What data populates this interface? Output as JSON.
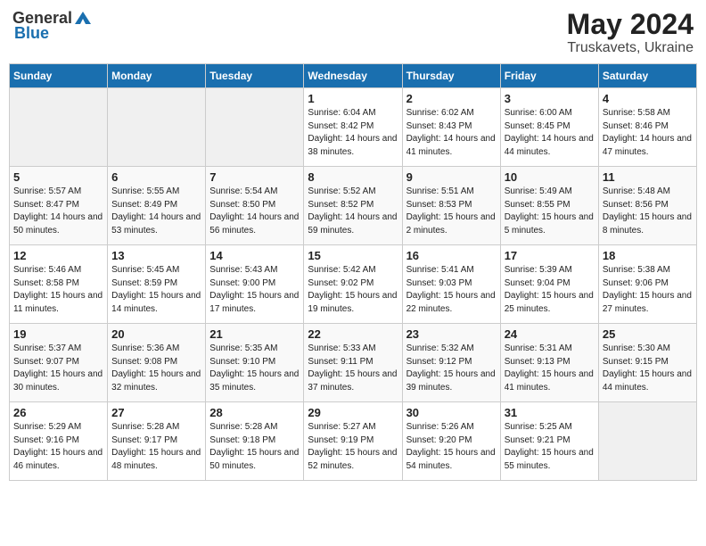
{
  "header": {
    "logo_general": "General",
    "logo_blue": "Blue",
    "month": "May 2024",
    "location": "Truskavets, Ukraine"
  },
  "days_of_week": [
    "Sunday",
    "Monday",
    "Tuesday",
    "Wednesday",
    "Thursday",
    "Friday",
    "Saturday"
  ],
  "weeks": [
    [
      {
        "day": "",
        "sunrise": "",
        "sunset": "",
        "daylight": "",
        "empty": true
      },
      {
        "day": "",
        "sunrise": "",
        "sunset": "",
        "daylight": "",
        "empty": true
      },
      {
        "day": "",
        "sunrise": "",
        "sunset": "",
        "daylight": "",
        "empty": true
      },
      {
        "day": "1",
        "sunrise": "Sunrise: 6:04 AM",
        "sunset": "Sunset: 8:42 PM",
        "daylight": "Daylight: 14 hours and 38 minutes."
      },
      {
        "day": "2",
        "sunrise": "Sunrise: 6:02 AM",
        "sunset": "Sunset: 8:43 PM",
        "daylight": "Daylight: 14 hours and 41 minutes."
      },
      {
        "day": "3",
        "sunrise": "Sunrise: 6:00 AM",
        "sunset": "Sunset: 8:45 PM",
        "daylight": "Daylight: 14 hours and 44 minutes."
      },
      {
        "day": "4",
        "sunrise": "Sunrise: 5:58 AM",
        "sunset": "Sunset: 8:46 PM",
        "daylight": "Daylight: 14 hours and 47 minutes."
      }
    ],
    [
      {
        "day": "5",
        "sunrise": "Sunrise: 5:57 AM",
        "sunset": "Sunset: 8:47 PM",
        "daylight": "Daylight: 14 hours and 50 minutes."
      },
      {
        "day": "6",
        "sunrise": "Sunrise: 5:55 AM",
        "sunset": "Sunset: 8:49 PM",
        "daylight": "Daylight: 14 hours and 53 minutes."
      },
      {
        "day": "7",
        "sunrise": "Sunrise: 5:54 AM",
        "sunset": "Sunset: 8:50 PM",
        "daylight": "Daylight: 14 hours and 56 minutes."
      },
      {
        "day": "8",
        "sunrise": "Sunrise: 5:52 AM",
        "sunset": "Sunset: 8:52 PM",
        "daylight": "Daylight: 14 hours and 59 minutes."
      },
      {
        "day": "9",
        "sunrise": "Sunrise: 5:51 AM",
        "sunset": "Sunset: 8:53 PM",
        "daylight": "Daylight: 15 hours and 2 minutes."
      },
      {
        "day": "10",
        "sunrise": "Sunrise: 5:49 AM",
        "sunset": "Sunset: 8:55 PM",
        "daylight": "Daylight: 15 hours and 5 minutes."
      },
      {
        "day": "11",
        "sunrise": "Sunrise: 5:48 AM",
        "sunset": "Sunset: 8:56 PM",
        "daylight": "Daylight: 15 hours and 8 minutes."
      }
    ],
    [
      {
        "day": "12",
        "sunrise": "Sunrise: 5:46 AM",
        "sunset": "Sunset: 8:58 PM",
        "daylight": "Daylight: 15 hours and 11 minutes."
      },
      {
        "day": "13",
        "sunrise": "Sunrise: 5:45 AM",
        "sunset": "Sunset: 8:59 PM",
        "daylight": "Daylight: 15 hours and 14 minutes."
      },
      {
        "day": "14",
        "sunrise": "Sunrise: 5:43 AM",
        "sunset": "Sunset: 9:00 PM",
        "daylight": "Daylight: 15 hours and 17 minutes."
      },
      {
        "day": "15",
        "sunrise": "Sunrise: 5:42 AM",
        "sunset": "Sunset: 9:02 PM",
        "daylight": "Daylight: 15 hours and 19 minutes."
      },
      {
        "day": "16",
        "sunrise": "Sunrise: 5:41 AM",
        "sunset": "Sunset: 9:03 PM",
        "daylight": "Daylight: 15 hours and 22 minutes."
      },
      {
        "day": "17",
        "sunrise": "Sunrise: 5:39 AM",
        "sunset": "Sunset: 9:04 PM",
        "daylight": "Daylight: 15 hours and 25 minutes."
      },
      {
        "day": "18",
        "sunrise": "Sunrise: 5:38 AM",
        "sunset": "Sunset: 9:06 PM",
        "daylight": "Daylight: 15 hours and 27 minutes."
      }
    ],
    [
      {
        "day": "19",
        "sunrise": "Sunrise: 5:37 AM",
        "sunset": "Sunset: 9:07 PM",
        "daylight": "Daylight: 15 hours and 30 minutes."
      },
      {
        "day": "20",
        "sunrise": "Sunrise: 5:36 AM",
        "sunset": "Sunset: 9:08 PM",
        "daylight": "Daylight: 15 hours and 32 minutes."
      },
      {
        "day": "21",
        "sunrise": "Sunrise: 5:35 AM",
        "sunset": "Sunset: 9:10 PM",
        "daylight": "Daylight: 15 hours and 35 minutes."
      },
      {
        "day": "22",
        "sunrise": "Sunrise: 5:33 AM",
        "sunset": "Sunset: 9:11 PM",
        "daylight": "Daylight: 15 hours and 37 minutes."
      },
      {
        "day": "23",
        "sunrise": "Sunrise: 5:32 AM",
        "sunset": "Sunset: 9:12 PM",
        "daylight": "Daylight: 15 hours and 39 minutes."
      },
      {
        "day": "24",
        "sunrise": "Sunrise: 5:31 AM",
        "sunset": "Sunset: 9:13 PM",
        "daylight": "Daylight: 15 hours and 41 minutes."
      },
      {
        "day": "25",
        "sunrise": "Sunrise: 5:30 AM",
        "sunset": "Sunset: 9:15 PM",
        "daylight": "Daylight: 15 hours and 44 minutes."
      }
    ],
    [
      {
        "day": "26",
        "sunrise": "Sunrise: 5:29 AM",
        "sunset": "Sunset: 9:16 PM",
        "daylight": "Daylight: 15 hours and 46 minutes."
      },
      {
        "day": "27",
        "sunrise": "Sunrise: 5:28 AM",
        "sunset": "Sunset: 9:17 PM",
        "daylight": "Daylight: 15 hours and 48 minutes."
      },
      {
        "day": "28",
        "sunrise": "Sunrise: 5:28 AM",
        "sunset": "Sunset: 9:18 PM",
        "daylight": "Daylight: 15 hours and 50 minutes."
      },
      {
        "day": "29",
        "sunrise": "Sunrise: 5:27 AM",
        "sunset": "Sunset: 9:19 PM",
        "daylight": "Daylight: 15 hours and 52 minutes."
      },
      {
        "day": "30",
        "sunrise": "Sunrise: 5:26 AM",
        "sunset": "Sunset: 9:20 PM",
        "daylight": "Daylight: 15 hours and 54 minutes."
      },
      {
        "day": "31",
        "sunrise": "Sunrise: 5:25 AM",
        "sunset": "Sunset: 9:21 PM",
        "daylight": "Daylight: 15 hours and 55 minutes."
      },
      {
        "day": "",
        "sunrise": "",
        "sunset": "",
        "daylight": "",
        "empty": true
      }
    ]
  ]
}
